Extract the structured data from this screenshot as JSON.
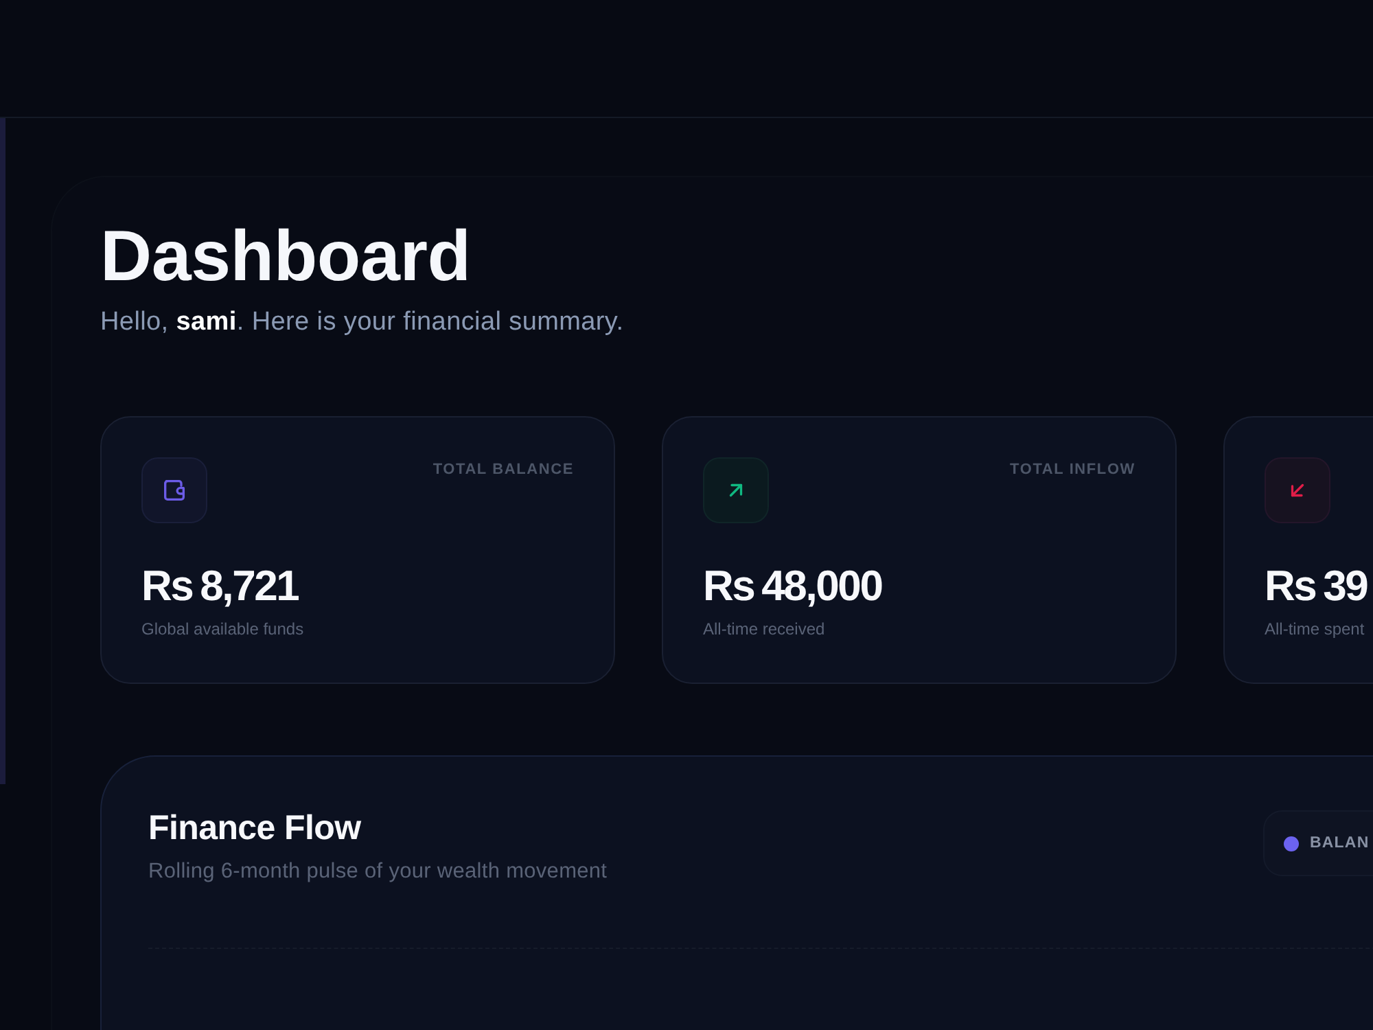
{
  "header": {
    "title": "Dashboard",
    "greeting": "Hello, **sami**. Here is your financial summary."
  },
  "stat_cards": [
    {
      "kind": "balance",
      "label": "TOTAL BALANCE",
      "value": "Rs 8,721",
      "caption": "Global available funds"
    },
    {
      "kind": "inflow",
      "label": "TOTAL INFLOW",
      "value": "Rs 48,000",
      "caption": "All-time received"
    },
    {
      "kind": "outflow",
      "value": "Rs 39",
      "caption": "All-time spent"
    }
  ],
  "finance_flow": {
    "title": "Finance Flow",
    "subtitle": "Rolling 6-month pulse of your wealth movement",
    "legend": [
      {
        "label": "BALAN",
        "color": "#6c63f0"
      }
    ]
  }
}
